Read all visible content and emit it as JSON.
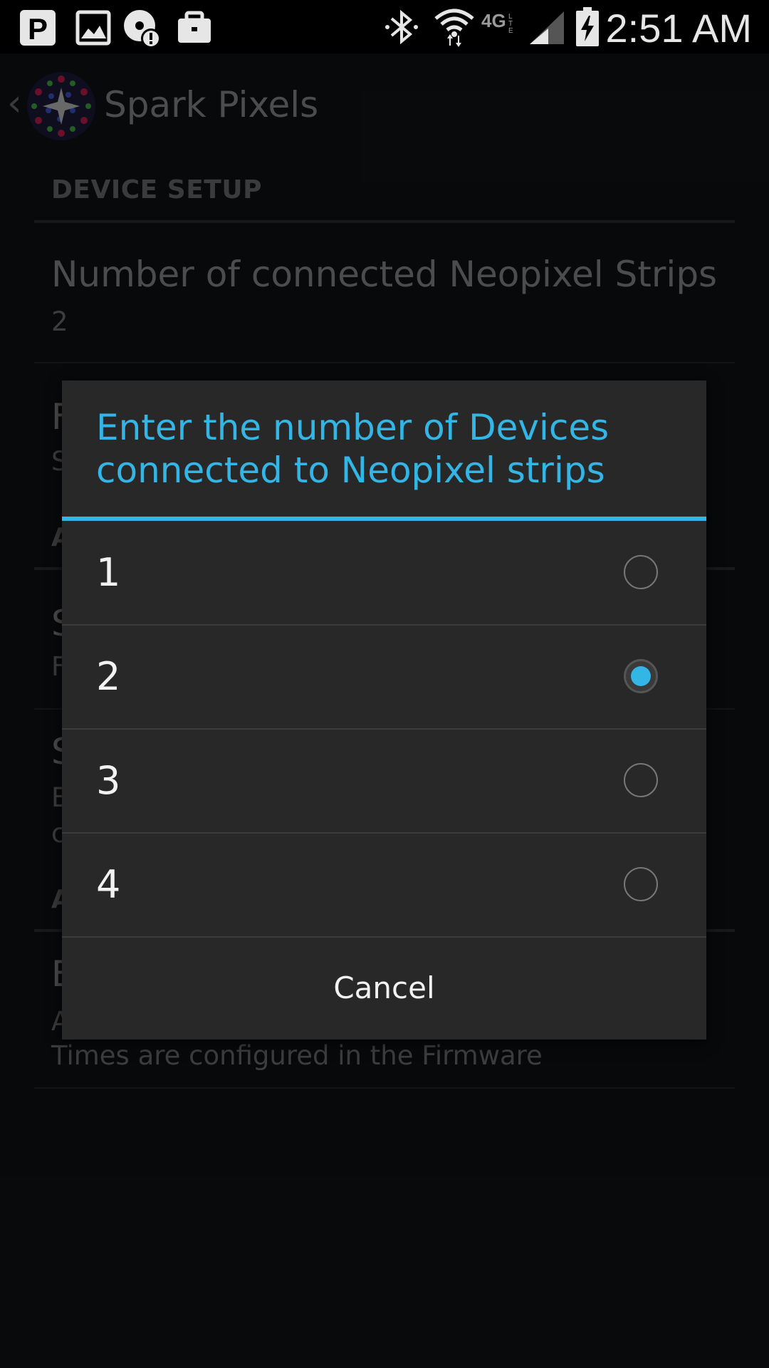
{
  "status_bar": {
    "time": "2:51 AM",
    "left_icons": [
      "parking-icon",
      "image-icon",
      "alert-disc-icon",
      "briefcase-icon"
    ],
    "right_icons": [
      "bluetooth-icon",
      "wifi-icon",
      "lte-icon",
      "signal-icon",
      "battery-charging-icon"
    ],
    "network_label": "4G LTE"
  },
  "action_bar": {
    "app_title": "Spark Pixels"
  },
  "settings": {
    "category_1": "DEVICE SETUP",
    "pref_1_title": "Number of connected Neopixel Strips",
    "pref_1_summary": "2",
    "pref_2_title_fragment": "F",
    "pref_2_summary_fragment": "S",
    "category_2_fragment": "A",
    "pref_3_title_fragment": "S",
    "pref_3_summary_fragment": "F",
    "pref_4_title_fragment": "S",
    "pref_4_summary_fragment_1": "E",
    "pref_4_summary_fragment_2": "c",
    "category_3_fragment": "A",
    "pref_5_title_fragment": "E",
    "pref_5_summary_fragment": "A",
    "pref_5_summary_line_2": "Times are configured in the Firmware"
  },
  "dialog": {
    "title": "Enter the number of Devices connected to Neopixel strips",
    "options": [
      {
        "label": "1",
        "checked": false
      },
      {
        "label": "2",
        "checked": true
      },
      {
        "label": "3",
        "checked": false
      },
      {
        "label": "4",
        "checked": false
      }
    ],
    "cancel_label": "Cancel",
    "accent_color": "#33b5e5"
  }
}
